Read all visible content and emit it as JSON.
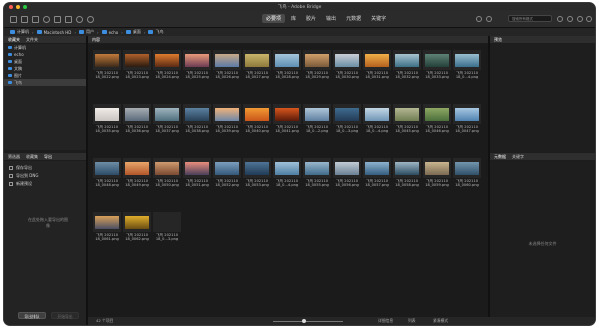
{
  "window": {
    "title": "飞鸟 - Adobe Bridge"
  },
  "toolbar": {
    "workspaces": [
      "必要项",
      "库",
      "胶片",
      "输出",
      "元数据",
      "关键字"
    ],
    "active_workspace": 0,
    "search_placeholder": "搜索所有格式"
  },
  "path": [
    "计算机",
    "Macintosh HD",
    "用户",
    "echo",
    "桌面",
    "飞鸟"
  ],
  "favorites_panel": {
    "tabs": [
      "收藏夹",
      "文件夹"
    ],
    "items": [
      "计算机",
      "echo",
      "桌面",
      "文稿",
      "图片",
      "飞鸟"
    ],
    "selected": 5
  },
  "export_panel": {
    "tabs": [
      "筛选器",
      "收藏集",
      "导出"
    ],
    "active_tab": 2,
    "items": [
      "保存导出",
      "导出到 DNG",
      "新建预设"
    ],
    "hint": "在此处拖入要导出的图像",
    "buttons": [
      "导出排队",
      "开始导出"
    ]
  },
  "content": {
    "title": "内容",
    "thumbnails": [
      {
        "c1": "#3b2a1a",
        "c2": "#c27a3a",
        "l1": "飞鸟 202110",
        "l2": "18_0022.png"
      },
      {
        "c1": "#2a1b10",
        "c2": "#b1602a",
        "l1": "飞鸟 202110",
        "l2": "18_0023.png"
      },
      {
        "c1": "#5a2a14",
        "c2": "#e07b2e",
        "l1": "飞鸟 202110",
        "l2": "18_0024.png"
      },
      {
        "c1": "#6c3b52",
        "c2": "#e89a7a",
        "l1": "飞鸟 202110",
        "l2": "18_0025.png"
      },
      {
        "c1": "#5b7aa6",
        "c2": "#c8a889",
        "l1": "飞鸟 202110",
        "l2": "18_0026.png"
      },
      {
        "c1": "#8f7a3c",
        "c2": "#c9b46a",
        "l1": "飞鸟 202110",
        "l2": "18_0027.png"
      },
      {
        "c1": "#5d8fb2",
        "c2": "#a7c6db",
        "l1": "飞鸟 202110",
        "l2": "18_0028.png"
      },
      {
        "c1": "#7a5a3a",
        "c2": "#d2a06a",
        "l1": "飞鸟 202110",
        "l2": "18_0029.png"
      },
      {
        "c1": "#6b8fa6",
        "c2": "#c9ced4",
        "l1": "飞鸟 202110",
        "l2": "18_0030.png"
      },
      {
        "c1": "#b5601e",
        "c2": "#f0b048",
        "l1": "飞鸟 202110",
        "l2": "18_0031.png"
      },
      {
        "c1": "#3d6f86",
        "c2": "#a7c3cf",
        "l1": "飞鸟 202110",
        "l2": "18_0032.png"
      },
      {
        "c1": "#24413a",
        "c2": "#5e8275",
        "l1": "飞鸟 202110",
        "l2": "18_0033.png"
      },
      {
        "c1": "#3b6f8c",
        "c2": "#99bed0",
        "l1": "飞鸟 202110",
        "l2": "18_0...4.png"
      },
      {
        "c1": "#c9c4c0",
        "c2": "#f0ece8",
        "l1": "飞鸟 202110",
        "l2": "18_0035.png"
      },
      {
        "c1": "#5a6a7a",
        "c2": "#a8aeb3",
        "l1": "飞鸟 202110",
        "l2": "18_0036.png"
      },
      {
        "c1": "#4f6e7d",
        "c2": "#9fb5bf",
        "l1": "飞鸟 202110",
        "l2": "18_0037.png"
      },
      {
        "c1": "#274056",
        "c2": "#5d82a2",
        "l1": "飞鸟 202110",
        "l2": "18_0038.png"
      },
      {
        "c1": "#6d86a8",
        "c2": "#f0b27a",
        "l1": "飞鸟 202110",
        "l2": "18_0039.png"
      },
      {
        "c1": "#c9561a",
        "c2": "#f29a34",
        "l1": "飞鸟 202110",
        "l2": "18_0040.png"
      },
      {
        "c1": "#5a1a0a",
        "c2": "#d8571d",
        "l1": "飞鸟 202110",
        "l2": "18_0041.png"
      },
      {
        "c1": "#5e7fa1",
        "c2": "#b0c7d8",
        "l1": "飞鸟 202110",
        "l2": "18_0...2.png"
      },
      {
        "c1": "#223b56",
        "c2": "#3f6b8f",
        "l1": "飞鸟 202110",
        "l2": "18_0...3.png"
      },
      {
        "c1": "#6f95b6",
        "c2": "#c3d7e4",
        "l1": "飞鸟 202110",
        "l2": "18_0...4.png"
      },
      {
        "c1": "#6f7c52",
        "c2": "#b4b893",
        "l1": "飞鸟 202110",
        "l2": "18_0045.png"
      },
      {
        "c1": "#4b6e3a",
        "c2": "#8fa964",
        "l1": "飞鸟 202110",
        "l2": "18_0046.png"
      },
      {
        "c1": "#4f82b0",
        "c2": "#a8c8e2",
        "l1": "飞鸟 202110",
        "l2": "18_0047.png"
      },
      {
        "c1": "#2d4b66",
        "c2": "#6e8ea8",
        "l1": "飞鸟 202110",
        "l2": "18_0048.png"
      },
      {
        "c1": "#b2562a",
        "c2": "#e8a56a",
        "l1": "飞鸟 202110",
        "l2": "18_0049.png"
      },
      {
        "c1": "#7a4a32",
        "c2": "#cf9a6f",
        "l1": "飞鸟 202110",
        "l2": "18_0050.png"
      },
      {
        "c1": "#4a3f5a",
        "c2": "#e98d7d",
        "l1": "飞鸟 202110",
        "l2": "18_0051.png"
      },
      {
        "c1": "#34587a",
        "c2": "#7c9fbe",
        "l1": "飞鸟 202110",
        "l2": "18_0052.png"
      },
      {
        "c1": "#1f3b55",
        "c2": "#4f7496",
        "l1": "飞鸟 202110",
        "l2": "18_0053.png"
      },
      {
        "c1": "#4f7ea3",
        "c2": "#9ec1d8",
        "l1": "飞鸟 202110",
        "l2": "18_0...4.png"
      },
      {
        "c1": "#3f6b8a",
        "c2": "#98b6cc",
        "l1": "飞鸟 202110",
        "l2": "18_0055.png"
      },
      {
        "c1": "#6a8094",
        "c2": "#c2ccd5",
        "l1": "飞鸟 202110",
        "l2": "18_0056.png"
      },
      {
        "c1": "#345d7f",
        "c2": "#8cb2cf",
        "l1": "飞鸟 202110",
        "l2": "18_0057.png"
      },
      {
        "c1": "#2c4b5f",
        "c2": "#9db6c6",
        "l1": "飞鸟 202110",
        "l2": "18_0058.png"
      },
      {
        "c1": "#7b6a52",
        "c2": "#c8b48f",
        "l1": "飞鸟 202110",
        "l2": "18_0059.png"
      },
      {
        "c1": "#2f5068",
        "c2": "#7396ae",
        "l1": "飞鸟 202110",
        "l2": "18_0060.png"
      },
      {
        "c1": "#4a4f63",
        "c2": "#d9a059",
        "l1": "飞鸟 202110",
        "l2": "18_0061.png"
      },
      {
        "c1": "#6a4e12",
        "c2": "#e0ad2c",
        "l1": "飞鸟 202110",
        "l2": "18_0062.png"
      },
      {
        "c1": "#262626",
        "c2": "#262626",
        "l1": "飞鸟 202110",
        "l2": "18_0...3.png"
      }
    ]
  },
  "preview_panel": {
    "title": "预览"
  },
  "metadata_panel": {
    "tabs": [
      "元数据",
      "关键字"
    ],
    "note": "未选择任何文件"
  },
  "statusbar": {
    "count": "42 个项目",
    "view_labels": [
      "详细信息",
      "列表",
      "紧凑模式"
    ]
  }
}
